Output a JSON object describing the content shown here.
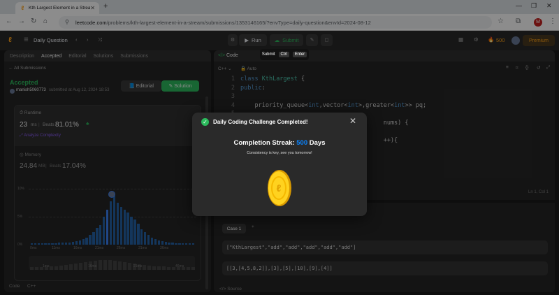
{
  "browser": {
    "tab_title": "Kth Largest Element in a Strea",
    "url_host": "leetcode.com",
    "url_path": "/problems/kth-largest-element-in-a-stream/submissions/1353146165/?envType=daily-question&envId=2024-08-12"
  },
  "nav": {
    "daily_question": "Daily Question",
    "run": "Run",
    "submit": "Submit",
    "coins": "500",
    "premium": "Premium"
  },
  "tooltip": {
    "label": "Submit",
    "key1": "Ctrl",
    "key2": "Enter"
  },
  "left": {
    "tabs": [
      "Description",
      "Accepted",
      "Editorial",
      "Solutions",
      "Submissions"
    ],
    "all_submissions": "All Submissions",
    "status": "Accepted",
    "user": "manish5060773",
    "submitted_at": "submitted at Aug 12, 2024 18:53",
    "editorial_btn": "Editorial",
    "solution_btn": "Solution",
    "runtime_label": "Runtime",
    "runtime_value": "23",
    "runtime_unit": "ms",
    "runtime_beats_label": "Beats",
    "runtime_beats": "81.01%",
    "analyze": "Analyze Complexity",
    "memory_label": "Memory",
    "memory_value": "24.84",
    "memory_unit": "MB",
    "memory_beats_label": "Beats",
    "memory_beats": "17.04%",
    "y_ticks": [
      "10%",
      "5%",
      "0%"
    ],
    "x_ticks": [
      "0ms",
      "11ms",
      "16ms",
      "21ms",
      "26ms",
      "31ms",
      "36ms"
    ],
    "mini_ticks": [
      "1ms",
      "16ms",
      "21ms",
      "46ms"
    ],
    "footer_code": "Code",
    "footer_lang": "C++"
  },
  "right": {
    "header": "Code",
    "lang": "C++",
    "auto": "Auto",
    "lines": [
      {
        "n": "1",
        "text": "class KthLargest {"
      },
      {
        "n": "2",
        "text": "public:"
      },
      {
        "n": "3",
        "text": ""
      },
      {
        "n": "4",
        "text": "    priority_queue<int,vector<int>,greater<int>> pq;"
      },
      {
        "n": "5",
        "text": ""
      },
      {
        "n": "6",
        "text": "                                        nums) {"
      },
      {
        "n": "7",
        "text": ""
      },
      {
        "n": "8",
        "text": "                                        ++){"
      }
    ],
    "cursor_pos": "Ln 1, Col 1",
    "case_tab": "Case 1",
    "input1": "[\"KthLargest\",\"add\",\"add\",\"add\",\"add\",\"add\"]",
    "input2": "[[3,[4,5,8,2]],[3],[5],[10],[9],[4]]",
    "source": "Source"
  },
  "modal": {
    "title": "Daily Coding Challenge Completed!",
    "streak_label": "Completion Streak:",
    "streak_value": "500",
    "streak_unit": "Days",
    "message": "Consistency is key, see you tomorrow!"
  },
  "colors": {
    "accent": "#ffa116",
    "green": "#2cbb5d",
    "blue": "#3b82f6",
    "link": "#0a84ff"
  }
}
